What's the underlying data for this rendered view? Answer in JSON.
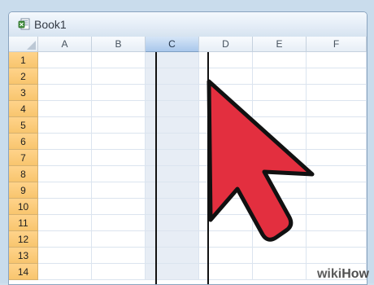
{
  "window": {
    "title": "Book1"
  },
  "spreadsheet": {
    "columns": [
      "A",
      "B",
      "C",
      "D",
      "E",
      "F"
    ],
    "rows": [
      "1",
      "2",
      "3",
      "4",
      "5",
      "6",
      "7",
      "8",
      "9",
      "10",
      "11",
      "12",
      "13",
      "14"
    ],
    "selected_column": "C"
  },
  "cursor": {
    "icon": "mouse-pointer-icon",
    "color": "#e32f3f"
  },
  "watermark": {
    "part1": "wiki",
    "part2": "How"
  },
  "colors": {
    "background": "#c9dcec",
    "row_header_fill": "#f8c56e",
    "selected_header_fill": "#a9c7eb",
    "selected_column_fill": "#e7edf5"
  }
}
